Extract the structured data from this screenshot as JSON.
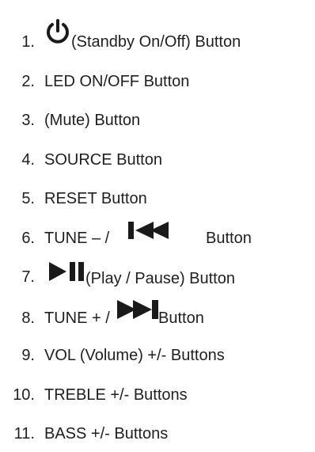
{
  "list": {
    "items": [
      {
        "num": "1.",
        "icon": "power-icon",
        "text": "(Standby On/Off) Button"
      },
      {
        "num": "2.",
        "text": "LED ON/OFF Button"
      },
      {
        "num": "3.",
        "text": "(Mute) Button"
      },
      {
        "num": "4.",
        "text": "SOURCE Button"
      },
      {
        "num": "5.",
        "text": "RESET Button"
      },
      {
        "num": "6.",
        "text_before": "TUNE – /",
        "icon": "skip-back-icon",
        "text_after": "Button"
      },
      {
        "num": "7.",
        "icon": "play-pause-icon",
        "text": "(Play / Pause) Button"
      },
      {
        "num": "8.",
        "text_before": "TUNE + /",
        "icon": "skip-forward-icon",
        "text_after": "Button"
      },
      {
        "num": "9.",
        "text": "VOL (Volume) +/- Buttons"
      },
      {
        "num": "10.",
        "text": "TREBLE +/- Buttons"
      },
      {
        "num": "11.",
        "text": "BASS +/- Buttons"
      }
    ]
  },
  "colors": {
    "text": "#1f1f1f",
    "icon": "#1a1a1a"
  }
}
